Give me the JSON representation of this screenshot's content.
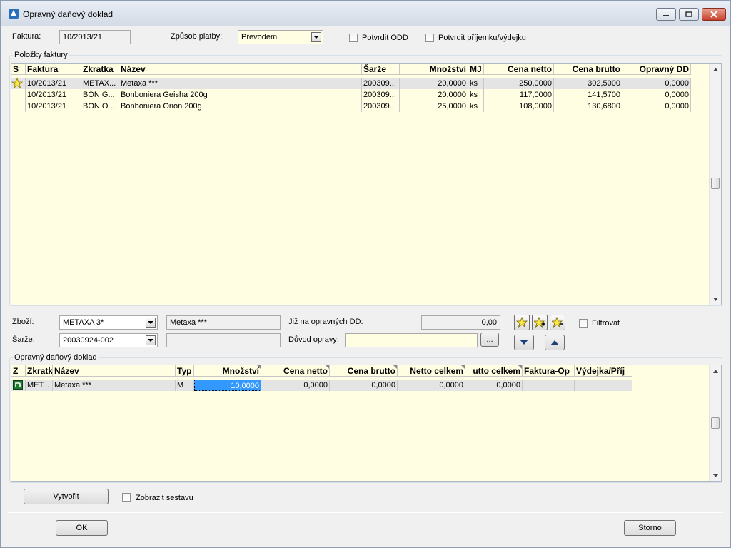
{
  "window": {
    "title": "Opravný daňový doklad"
  },
  "header": {
    "faktura_label": "Faktura:",
    "faktura_value": "10/2013/21",
    "zpusob_label": "Způsob platby:",
    "zpusob_value": "Převodem",
    "potvrdit_odd_label": "Potvrdit ODD",
    "potvrdit_prijemku_label": "Potvrdit příjemku/výdejku"
  },
  "invoice_items": {
    "group_title": "Položky faktury",
    "columns": [
      "S",
      "Faktura",
      "Zkratka",
      "Název",
      "Šarže",
      "Množství",
      "MJ",
      "Cena netto",
      "Cena brutto",
      "Opravný DD"
    ],
    "rows": [
      [
        "",
        "10/2013/21",
        "METAX...",
        "Metaxa ***",
        "200309...",
        "20,0000",
        "ks",
        "250,0000",
        "302,5000",
        "0,0000"
      ],
      [
        "",
        "10/2013/21",
        "BON G...",
        "Bonboniera Geisha 200g",
        "200309...",
        "20,0000",
        "ks",
        "117,0000",
        "141,5700",
        "0,0000"
      ],
      [
        "",
        "10/2013/21",
        "BON O...",
        "Bonboniera Orion 200g",
        "200309...",
        "25,0000",
        "ks",
        "108,0000",
        "130,6800",
        "0,0000"
      ]
    ]
  },
  "detail": {
    "zbozi_label": "Zboží:",
    "zbozi_value": "METAXA 3*",
    "zbozi_name": "Metaxa ***",
    "sarze_label": "Šarže:",
    "sarze_value": "20030924-002",
    "sarze_name": "",
    "jiz_label": "Již na opravných DD:",
    "jiz_value": "0,00",
    "duvod_label": "Důvod opravy:",
    "duvod_value": "",
    "ellipsis": "...",
    "filtrovat_label": "Filtrovat"
  },
  "correction": {
    "group_title": "Opravný daňový doklad",
    "columns": [
      "Z",
      "Zkratk",
      "Název",
      "Typ",
      "Množství",
      "Cena netto",
      "Cena brutto",
      "Netto celkem",
      "utto celkem",
      "Faktura-Op",
      "Výdejka/Příj"
    ],
    "rows": [
      [
        "",
        "MET...",
        "Metaxa ***",
        "M",
        "10,0000",
        "0,0000",
        "0,0000",
        "0,0000",
        "0,0000",
        "",
        ""
      ]
    ]
  },
  "footer": {
    "vytvorit_label": "Vytvořit",
    "zobrazit_label": "Zobrazit sestavu",
    "ok_label": "OK",
    "storno_label": "Storno"
  },
  "colors": {
    "grid_background": "#fffde2",
    "selection": "#3399ff"
  }
}
